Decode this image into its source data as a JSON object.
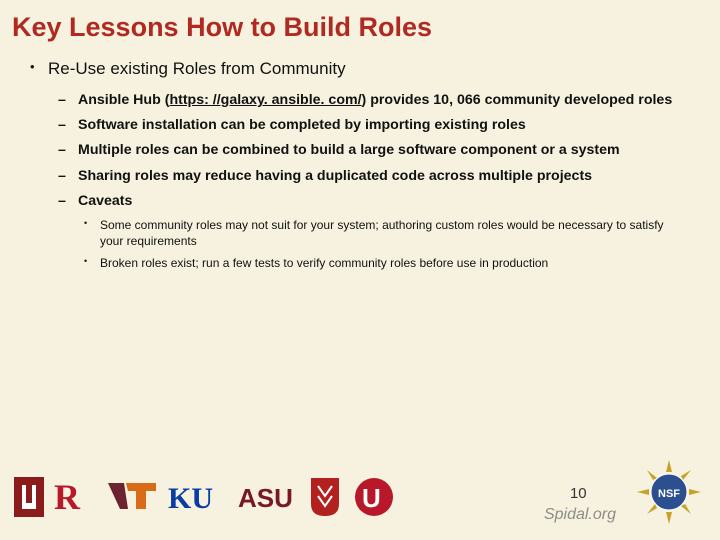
{
  "title": "Key Lessons How to Build Roles",
  "items": {
    "l1": "Re-Use existing Roles from Community",
    "l2a_pre": "Ansible Hub (",
    "l2a_link": "https: //galaxy. ansible. com/",
    "l2a_post": ") provides 10, 066 community developed roles",
    "l2b": "Software installation can be completed by importing existing roles",
    "l2c": "Multiple roles can be combined to build a large software component or a system",
    "l2d": "Sharing roles may reduce having a duplicated code across multiple projects",
    "l2e": "Caveats",
    "l3a": "Some community roles may not suit for your system; authoring custom roles would be necessary to satisfy your requirements",
    "l3b": "Broken roles exist; run a few tests to verify community roles before use in production"
  },
  "footer": {
    "page": "10",
    "brand": "Spidal.org"
  },
  "logos": [
    "iu",
    "rutgers",
    "vt",
    "ku",
    "asu",
    "stonybrook",
    "utah",
    "nsf"
  ]
}
